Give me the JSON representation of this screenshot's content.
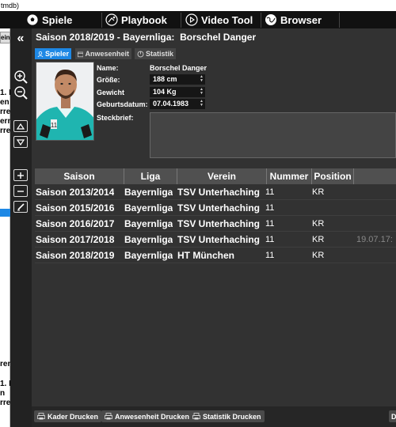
{
  "window": {
    "title": "tmdb)"
  },
  "topnav": [
    {
      "label": "Spiele",
      "icon": "soccer-ball-icon"
    },
    {
      "label": "Playbook",
      "icon": "playbook-icon"
    },
    {
      "label": "Video Tool",
      "icon": "play-circle-icon"
    },
    {
      "label": "Browser",
      "icon": "globe-icon"
    }
  ],
  "left_column": {
    "button_label": "ein",
    "collapse_label": "«",
    "upper_text": [
      "1. H",
      "en",
      "rre",
      "ern",
      "rre"
    ],
    "lower_text": [
      "ren",
      "1. H",
      "n",
      "rre"
    ]
  },
  "header": {
    "season": "Saison 2018/2019 - Bayernliga:",
    "player": "Borschel Danger"
  },
  "tabs": [
    {
      "label": "Spieler",
      "active": true
    },
    {
      "label": "Anwesenheit",
      "active": false
    },
    {
      "label": "Statistik",
      "active": false
    }
  ],
  "form": {
    "name_label": "Name:",
    "name_value": "Borschel Danger",
    "height_label": "Größe:",
    "height_value": "188 cm",
    "weight_label": "Gewicht",
    "weight_value": "104 Kg",
    "birth_label": "Geburtsdatum:",
    "birth_value": "07.04.1983",
    "profile_label": "Steckbrief:"
  },
  "table": {
    "columns": [
      "Saison",
      "Liga",
      "Verein",
      "Nummer",
      "Position"
    ],
    "rows": [
      {
        "saison": "Saison 2013/2014",
        "liga": "Bayernliga",
        "verein": "TSV Unterhaching",
        "nummer": "11",
        "position": "KR",
        "extra": ""
      },
      {
        "saison": "Saison 2015/2016",
        "liga": "Bayernliga",
        "verein": "TSV Unterhaching",
        "nummer": "11",
        "position": "",
        "extra": ""
      },
      {
        "saison": "Saison 2016/2017",
        "liga": "Bayernliga",
        "verein": "TSV Unterhaching",
        "nummer": "11",
        "position": "KR",
        "extra": ""
      },
      {
        "saison": "Saison 2017/2018",
        "liga": "Bayernliga",
        "verein": "TSV Unterhaching",
        "nummer": "11",
        "position": "KR",
        "extra": "19.07.17:"
      },
      {
        "saison": "Saison 2018/2019",
        "liga": "Bayernliga",
        "verein": "HT München",
        "nummer": "11",
        "position": "KR",
        "extra": ""
      }
    ]
  },
  "footer": {
    "kader": "Kader Drucken",
    "anwesenheit": "Anwesenheit Drucken",
    "statistik": "Statistik Drucken",
    "right_stub": "D"
  },
  "colors": {
    "accent": "#1e88e5",
    "background": "#323232",
    "topbar": "#111111"
  }
}
